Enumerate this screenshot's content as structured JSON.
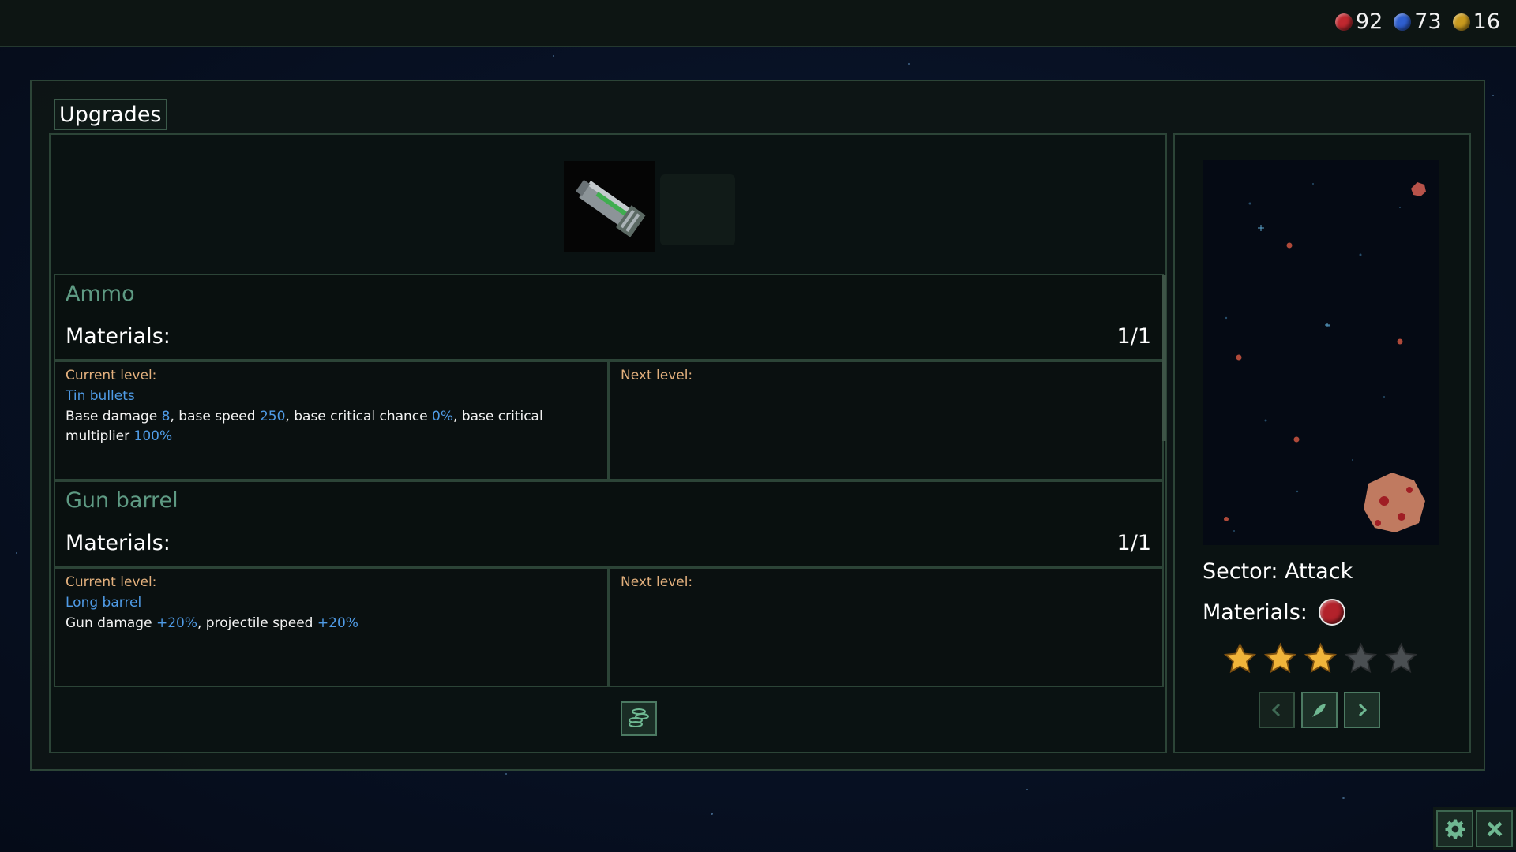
{
  "resources": [
    {
      "icon": "red-orb-icon",
      "color": "#c0282f",
      "value": "92"
    },
    {
      "icon": "blue-orb-icon",
      "color": "#2f5fcf",
      "value": "73"
    },
    {
      "icon": "gold-orb-icon",
      "color": "#c99a1e",
      "value": "16"
    }
  ],
  "window": {
    "title": "Upgrades"
  },
  "upgrades": [
    {
      "name": "Ammo",
      "materials_label": "Materials:",
      "materials_count": "1/1",
      "current_label": "Current level:",
      "next_label": "Next level:",
      "current_name": "Tin bullets",
      "desc": {
        "t1": "Base damage ",
        "v1": "8",
        "t2": ", base speed ",
        "v2": "250",
        "t3": ", base critical chance ",
        "v3": "0%",
        "t4": ", base critical multiplier ",
        "v4": "100%"
      }
    },
    {
      "name": "Gun barrel",
      "materials_label": "Materials:",
      "materials_count": "1/1",
      "current_label": "Current level:",
      "next_label": "Next level:",
      "current_name": "Long barrel",
      "desc": {
        "t1": "Gun damage ",
        "v1": "+20%",
        "t2": ", projectile speed ",
        "v2": "+20%"
      }
    }
  ],
  "sector": {
    "title": "Sector: Attack",
    "materials_label": "Materials:",
    "material_icon": "red-orb-icon",
    "stars_filled": 3,
    "stars_total": 5
  },
  "colors": {
    "accent_green": "#5e9a83",
    "highlight_blue": "#4f9be6",
    "label_orange": "#e3b07d",
    "star_gold": "#f0b43a"
  },
  "icons": {
    "item": "gun-barrel-icon",
    "craft_button": "coins-icon",
    "prev": "chevron-left-icon",
    "launch": "rocket-icon",
    "next": "chevron-right-icon",
    "settings": "gear-icon",
    "close": "close-icon"
  }
}
